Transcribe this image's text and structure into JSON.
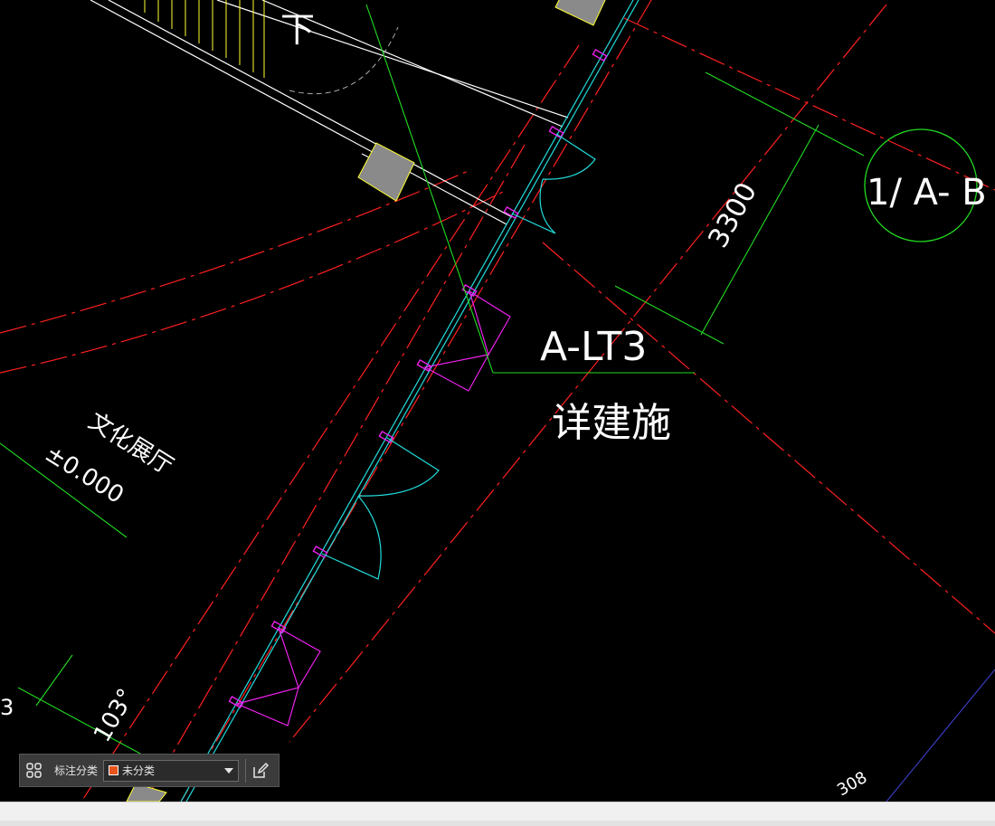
{
  "drawing": {
    "texts": {
      "stair_down": "下",
      "axis_bubble": "1/ A- B",
      "dimension": "3300",
      "tag_code": "A-LT3",
      "tag_note": "详建施",
      "room_name": "文化展厅",
      "elevation": "±0.000",
      "angle_partial": "103°",
      "left_edge_partial": "3",
      "bottom_right_partial": "308"
    },
    "colors": {
      "background": "#000000",
      "red_axis": "#ff2020",
      "white_wall": "#ffffff",
      "yellow": "#ffff33",
      "green": "#22dd22",
      "cyan": "#22dddd",
      "magenta": "#ee22ee",
      "gray_column": "#8a8a8a",
      "blue_partial": "#4444dd"
    }
  },
  "annotation_toolbar": {
    "grid_icon": "grid-four-icon",
    "label": "标注分类",
    "category_value": "未分类",
    "category_color": "#e8541c",
    "edit_icon": "edit-pencil-icon"
  }
}
